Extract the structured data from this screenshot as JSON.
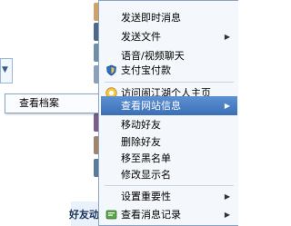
{
  "main_menu": {
    "items": [
      {
        "label": "发送即时消息"
      },
      {
        "label": "发送文件"
      },
      {
        "label": "语音/视频聊天"
      },
      {
        "label": "支付宝付款"
      },
      {
        "label": "访问闹江湖个人主页"
      },
      {
        "label": "查看网站信息"
      },
      {
        "label": "移动好友"
      },
      {
        "label": "删除好友"
      },
      {
        "label": "移至黑名单"
      },
      {
        "label": "修改显示名"
      },
      {
        "label": "设置重要性"
      },
      {
        "label": "查看消息记录"
      }
    ]
  },
  "submenu": {
    "items": [
      {
        "label": "查看档案"
      }
    ]
  },
  "background": {
    "bottom_label": "好友动向"
  },
  "colors": {
    "highlight": "#3f74bb",
    "menu_bg": "#f4f7fb",
    "border": "#8aa4c4"
  }
}
